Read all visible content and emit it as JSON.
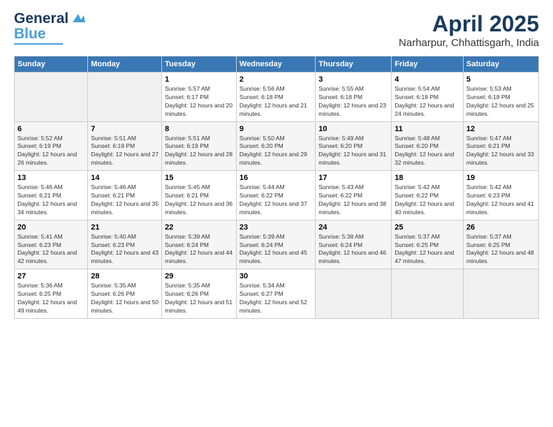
{
  "header": {
    "logo_line1": "General",
    "logo_line2": "Blue",
    "title": "April 2025",
    "subtitle": "Narharpur, Chhattisgarh, India"
  },
  "days_of_week": [
    "Sunday",
    "Monday",
    "Tuesday",
    "Wednesday",
    "Thursday",
    "Friday",
    "Saturday"
  ],
  "weeks": [
    [
      {
        "day": "",
        "info": ""
      },
      {
        "day": "",
        "info": ""
      },
      {
        "day": "1",
        "info": "Sunrise: 5:57 AM\nSunset: 6:17 PM\nDaylight: 12 hours and 20 minutes."
      },
      {
        "day": "2",
        "info": "Sunrise: 5:56 AM\nSunset: 6:18 PM\nDaylight: 12 hours and 21 minutes."
      },
      {
        "day": "3",
        "info": "Sunrise: 5:55 AM\nSunset: 6:18 PM\nDaylight: 12 hours and 23 minutes."
      },
      {
        "day": "4",
        "info": "Sunrise: 5:54 AM\nSunset: 6:18 PM\nDaylight: 12 hours and 24 minutes."
      },
      {
        "day": "5",
        "info": "Sunrise: 5:53 AM\nSunset: 6:18 PM\nDaylight: 12 hours and 25 minutes."
      }
    ],
    [
      {
        "day": "6",
        "info": "Sunrise: 5:52 AM\nSunset: 6:19 PM\nDaylight: 12 hours and 26 minutes."
      },
      {
        "day": "7",
        "info": "Sunrise: 5:51 AM\nSunset: 6:19 PM\nDaylight: 12 hours and 27 minutes."
      },
      {
        "day": "8",
        "info": "Sunrise: 5:51 AM\nSunset: 6:19 PM\nDaylight: 12 hours and 28 minutes."
      },
      {
        "day": "9",
        "info": "Sunrise: 5:50 AM\nSunset: 6:20 PM\nDaylight: 12 hours and 29 minutes."
      },
      {
        "day": "10",
        "info": "Sunrise: 5:49 AM\nSunset: 6:20 PM\nDaylight: 12 hours and 31 minutes."
      },
      {
        "day": "11",
        "info": "Sunrise: 5:48 AM\nSunset: 6:20 PM\nDaylight: 12 hours and 32 minutes."
      },
      {
        "day": "12",
        "info": "Sunrise: 5:47 AM\nSunset: 6:21 PM\nDaylight: 12 hours and 33 minutes."
      }
    ],
    [
      {
        "day": "13",
        "info": "Sunrise: 5:46 AM\nSunset: 6:21 PM\nDaylight: 12 hours and 34 minutes."
      },
      {
        "day": "14",
        "info": "Sunrise: 5:46 AM\nSunset: 6:21 PM\nDaylight: 12 hours and 35 minutes."
      },
      {
        "day": "15",
        "info": "Sunrise: 5:45 AM\nSunset: 6:21 PM\nDaylight: 12 hours and 36 minutes."
      },
      {
        "day": "16",
        "info": "Sunrise: 5:44 AM\nSunset: 6:22 PM\nDaylight: 12 hours and 37 minutes."
      },
      {
        "day": "17",
        "info": "Sunrise: 5:43 AM\nSunset: 6:22 PM\nDaylight: 12 hours and 38 minutes."
      },
      {
        "day": "18",
        "info": "Sunrise: 5:42 AM\nSunset: 6:22 PM\nDaylight: 12 hours and 40 minutes."
      },
      {
        "day": "19",
        "info": "Sunrise: 5:42 AM\nSunset: 6:23 PM\nDaylight: 12 hours and 41 minutes."
      }
    ],
    [
      {
        "day": "20",
        "info": "Sunrise: 5:41 AM\nSunset: 6:23 PM\nDaylight: 12 hours and 42 minutes."
      },
      {
        "day": "21",
        "info": "Sunrise: 5:40 AM\nSunset: 6:23 PM\nDaylight: 12 hours and 43 minutes."
      },
      {
        "day": "22",
        "info": "Sunrise: 5:39 AM\nSunset: 6:24 PM\nDaylight: 12 hours and 44 minutes."
      },
      {
        "day": "23",
        "info": "Sunrise: 5:39 AM\nSunset: 6:24 PM\nDaylight: 12 hours and 45 minutes."
      },
      {
        "day": "24",
        "info": "Sunrise: 5:38 AM\nSunset: 6:24 PM\nDaylight: 12 hours and 46 minutes."
      },
      {
        "day": "25",
        "info": "Sunrise: 5:37 AM\nSunset: 6:25 PM\nDaylight: 12 hours and 47 minutes."
      },
      {
        "day": "26",
        "info": "Sunrise: 5:37 AM\nSunset: 6:25 PM\nDaylight: 12 hours and 48 minutes."
      }
    ],
    [
      {
        "day": "27",
        "info": "Sunrise: 5:36 AM\nSunset: 6:25 PM\nDaylight: 12 hours and 49 minutes."
      },
      {
        "day": "28",
        "info": "Sunrise: 5:35 AM\nSunset: 6:26 PM\nDaylight: 12 hours and 50 minutes."
      },
      {
        "day": "29",
        "info": "Sunrise: 5:35 AM\nSunset: 6:26 PM\nDaylight: 12 hours and 51 minutes."
      },
      {
        "day": "30",
        "info": "Sunrise: 5:34 AM\nSunset: 6:27 PM\nDaylight: 12 hours and 52 minutes."
      },
      {
        "day": "",
        "info": ""
      },
      {
        "day": "",
        "info": ""
      },
      {
        "day": "",
        "info": ""
      }
    ]
  ]
}
